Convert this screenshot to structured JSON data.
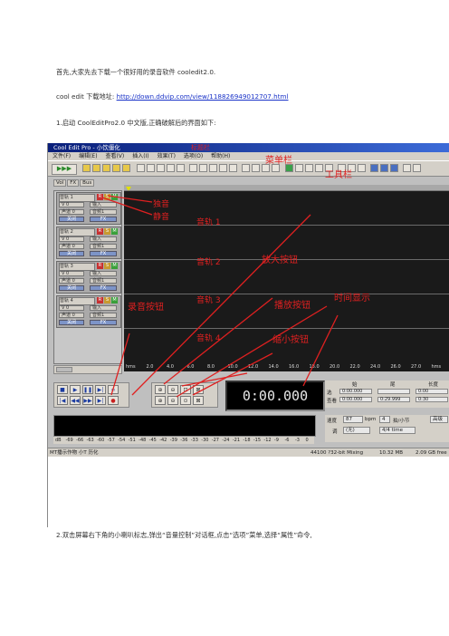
{
  "intro": "首先,大家先去下载一个很好用的录音软件 cooledit2.0.",
  "download": {
    "label": "cool edit 下载地址:",
    "url": "http://down.ddvip.com/view/118826949012707.html"
  },
  "step1": "1.启动 CoolEditPro2.0 中文版,正确破解后的界面如下:",
  "step2": "2.双击屏幕右下角的小喇叭标志,弹出“音量控制”对话框,点击“选项”菜单,选择“属性”命令,",
  "app": {
    "title": "Cool Edit Pro  - 小饮僵化",
    "menus": [
      "文件(F)",
      "编辑(E)",
      "查看(V)",
      "插入(I)",
      "效果(T)",
      "选项(O)",
      "帮助(H)"
    ],
    "tabs": [
      "Vol",
      "FX",
      "Bus"
    ],
    "track_controls": [
      {
        "name": "音轨 1",
        "row1a": "V 0",
        "row1b": "输入",
        "row2a": "声道 0",
        "row2b": "音频1",
        "row3a": "关闭",
        "row3b": "FX"
      },
      {
        "name": "音轨 2",
        "row1a": "V 0",
        "row1b": "输入",
        "row2a": "声道 0",
        "row2b": "音频1",
        "row3a": "关闭",
        "row3b": "FX"
      },
      {
        "name": "音轨 3",
        "row1a": "V 0",
        "row1b": "输入",
        "row2a": "声道 0",
        "row2b": "音频1",
        "row3a": "关闭",
        "row3b": "FX"
      },
      {
        "name": "音轨 4",
        "row1a": "V 0",
        "row1b": "输入",
        "row2a": "声道 0",
        "row2b": "音频1",
        "row3a": "关闭",
        "row3b": "FX"
      }
    ],
    "rsm": [
      "R",
      "S",
      "M"
    ],
    "timeline_ticks": [
      "hms",
      "2.0",
      "4.0",
      "6.0",
      "8.0",
      "10.0",
      "12.0",
      "14.0",
      "16.0",
      "18.0",
      "20.0",
      "22.0",
      "24.0",
      "26.0",
      "27.0",
      "hms"
    ],
    "time_display": "0:00.000",
    "sel_headers": [
      "始",
      "尾",
      "长度"
    ],
    "sel_rows": [
      {
        "label": "选",
        "start": "0:00.000",
        "end": "",
        "len": "0:00"
      },
      {
        "label": "查看",
        "start": "0:00.000",
        "end": "0:29.999",
        "len": "0:30"
      }
    ],
    "level_scale": [
      "dB",
      "-69",
      "-66",
      "-63",
      "-60",
      "-57",
      "-54",
      "-51",
      "-48",
      "-45",
      "-42",
      "-39",
      "-36",
      "-33",
      "-30",
      "-27",
      "-24",
      "-21",
      "-18",
      "-15",
      "-12",
      "-9",
      "-6",
      "-3",
      "0"
    ],
    "tempo": {
      "label": "速度",
      "bpm": "87",
      "bpm_unit": "bpm",
      "beats": "4",
      "beats_unit": "拍/小节",
      "key_label": "调",
      "key": "(无)",
      "time_sig": "4/4 time",
      "advanced": "高级"
    },
    "status": {
      "left": "MT播示作物 小T 历化",
      "rate": "44100 ?32-bit Mixing",
      "mem": "10.32 MB",
      "disk": "2.09 GB free"
    }
  },
  "annotations": {
    "title_bar": "标题栏",
    "menu_bar": "菜单栏",
    "toolbar": "工具栏",
    "record_solo": "独音",
    "mute": "静音",
    "track1": "音轨 1",
    "track2": "音轨 2",
    "track3": "音轨 3",
    "track4": "音轨 4",
    "zoom_in": "放大按钮",
    "play": "播放按钮",
    "time_display": "时间显示",
    "record_btn": "录音按钮",
    "zoom_out": "缩小按钮"
  },
  "colors": {
    "annotation": "#e02020",
    "link": "#1a33c8"
  }
}
